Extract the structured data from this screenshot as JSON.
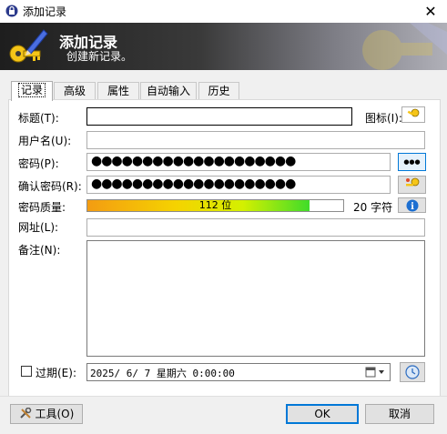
{
  "window": {
    "title": "添加记录",
    "close_glyph": "✕"
  },
  "banner": {
    "title": "添加记录",
    "subtitle": "创建新记录。"
  },
  "tabs": [
    {
      "label": "记录",
      "active": true
    },
    {
      "label": "高级",
      "active": false
    },
    {
      "label": "属性",
      "active": false
    },
    {
      "label": "自动输入",
      "active": false
    },
    {
      "label": "历史",
      "active": false
    }
  ],
  "form": {
    "title_label": "标题(T):",
    "title_value": "",
    "icon_label": "图标(I):",
    "username_label": "用户名(U):",
    "username_value": "",
    "password_label": "密码(P):",
    "password_value": "●●●●●●●●●●●●●●●●●●●●",
    "reveal_button_glyph": "●●●",
    "confirm_label": "确认密码(R):",
    "confirm_value": "●●●●●●●●●●●●●●●●●●●●",
    "quality_label": "密码质量:",
    "quality_text": "112 位",
    "quality_fraction": 0.87,
    "char_count": "20 字符",
    "info_icon": "i",
    "url_label": "网址(L):",
    "url_value": "",
    "notes_label": "备注(N):",
    "notes_value": "",
    "expiry_label": "过期(E):",
    "expiry_checked": false,
    "expiry_value": "2025/ 6/ 7 星期六  0:00:00"
  },
  "footer": {
    "tools_label": "工具(O)",
    "ok_label": "OK",
    "cancel_label": "取消"
  },
  "colors": {
    "accent": "#0078d7",
    "panel": "#f0f0f0",
    "info_blue": "#1c6fd1"
  }
}
